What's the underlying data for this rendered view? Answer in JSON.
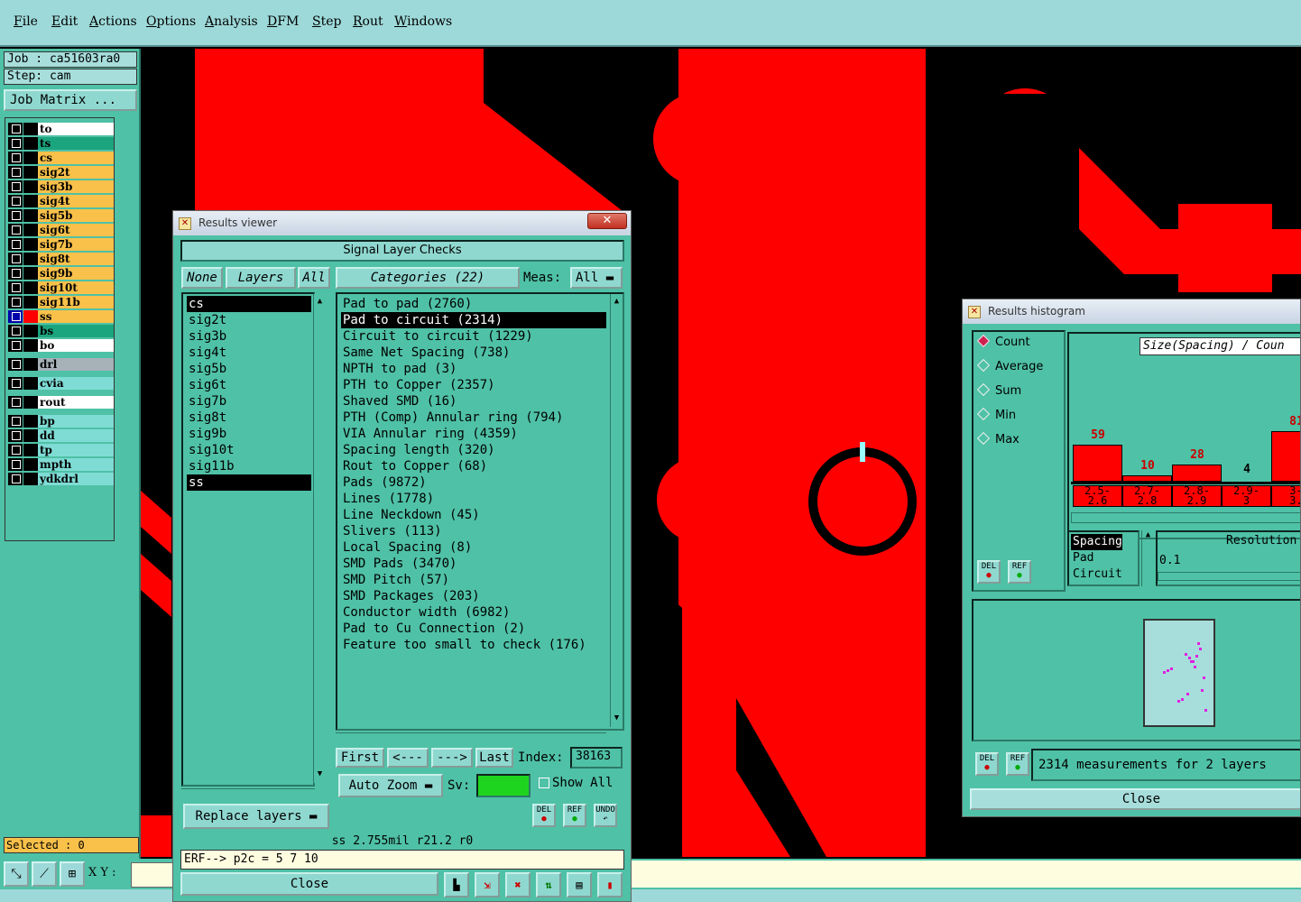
{
  "menu": [
    "File",
    "Edit",
    "Actions",
    "Options",
    "Analysis",
    "DFM",
    "Step",
    "Rout",
    "Windows"
  ],
  "left_panel": {
    "job": "Job : ca51603ra0",
    "step": "Step: cam",
    "job_matrix": "Job Matrix ...",
    "layers": [
      {
        "name": "to",
        "style": "white"
      },
      {
        "name": "ts",
        "style": "green"
      },
      {
        "name": "cs",
        "style": "orange"
      },
      {
        "name": "sig2t",
        "style": "orange"
      },
      {
        "name": "sig3b",
        "style": "orange"
      },
      {
        "name": "sig4t",
        "style": "orange"
      },
      {
        "name": "sig5b",
        "style": "orange"
      },
      {
        "name": "sig6t",
        "style": "orange"
      },
      {
        "name": "sig7b",
        "style": "orange"
      },
      {
        "name": "sig8t",
        "style": "orange"
      },
      {
        "name": "sig9b",
        "style": "orange"
      },
      {
        "name": "sig10t",
        "style": "orange"
      },
      {
        "name": "sig11b",
        "style": "orange"
      },
      {
        "name": "ss",
        "style": "orange"
      },
      {
        "name": "bs",
        "style": "green"
      },
      {
        "name": "bo",
        "style": "white"
      },
      {
        "name": "drl",
        "style": "grey"
      },
      {
        "name": "cvia",
        "style": "teal"
      },
      {
        "name": "rout",
        "style": "white"
      },
      {
        "name": "bp",
        "style": "teal"
      },
      {
        "name": "dd",
        "style": "teal"
      },
      {
        "name": "tp",
        "style": "teal"
      },
      {
        "name": "mpth",
        "style": "teal"
      },
      {
        "name": "ydkdrl",
        "style": "teal"
      }
    ],
    "selected": "Selected : 0"
  },
  "bottom_bar": {
    "xy_label": "X Y :"
  },
  "results_viewer": {
    "title": "Results viewer",
    "header": "Signal Layer Checks",
    "btn_none": "None",
    "btn_layers": "Layers",
    "btn_all": "All",
    "categories_btn": "Categories (22)",
    "meas_label": "Meas:",
    "meas_value": "All",
    "layers": [
      "cs",
      "sig2t",
      "sig3b",
      "sig4t",
      "sig5b",
      "sig6t",
      "sig7b",
      "sig8t",
      "sig9b",
      "sig10t",
      "sig11b",
      "ss"
    ],
    "categories": [
      "Pad to pad (2760)",
      "Pad to circuit (2314)",
      "Circuit to circuit (1229)",
      "Same Net Spacing (738)",
      "NPTH to pad (3)",
      "PTH to Copper (2357)",
      "Shaved SMD (16)",
      "PTH (Comp) Annular ring (794)",
      "VIA Annular ring (4359)",
      "Spacing length (320)",
      "Rout to Copper (68)",
      "Pads (9872)",
      "Lines (1778)",
      "Line Neckdown (45)",
      "Slivers (113)",
      "Local Spacing (8)",
      "SMD Pads (3470)",
      "SMD Pitch (57)",
      "SMD Packages (203)",
      "Conductor width (6982)",
      "Pad to Cu Connection (2)",
      "Feature too small to check (176)"
    ],
    "nav": {
      "first": "First",
      "prev": "<---",
      "next": "--->",
      "last": "Last",
      "index_label": "Index:",
      "index_value": "38163"
    },
    "auto_zoom": "Auto Zoom",
    "sv_label": "Sv:",
    "show_all": "Show All",
    "replace_layers": "Replace layers",
    "icons": {
      "del": "DEL",
      "ref": "REF",
      "undo": "UNDO"
    },
    "status": "ss 2.755mil  r21.2  r0",
    "erf": "ERF--> p2c = 5 7 10",
    "close": "Close"
  },
  "histogram": {
    "title": "Results histogram",
    "modes": [
      "Count",
      "Average",
      "Sum",
      "Min",
      "Max"
    ],
    "selected_mode": "Count",
    "chart_title": "Size(Spacing) / Coun",
    "bars": [
      {
        "label": "59",
        "bin": "2.5-\n2.6",
        "value": 59
      },
      {
        "label": "10",
        "bin": "2.7-\n2.8",
        "value": 10
      },
      {
        "label": "28",
        "bin": "2.8-\n2.9",
        "value": 28
      },
      {
        "label": "4",
        "bin": "2.9-\n3",
        "value": 4
      },
      {
        "label": "81",
        "bin": "3-\n3.",
        "value": 81
      }
    ],
    "measures": [
      "Spacing",
      "Pad",
      "Circuit"
    ],
    "resolution_label": "Resolution",
    "resolution_value": "0.1",
    "status": "2314 measurements for 2 layers",
    "close": "Close",
    "icons": {
      "del": "DEL",
      "ref": "REF"
    }
  },
  "colors": {
    "copper": "#ff0000",
    "panel": "#4fc1a6",
    "menu": "#9ed9d9"
  }
}
